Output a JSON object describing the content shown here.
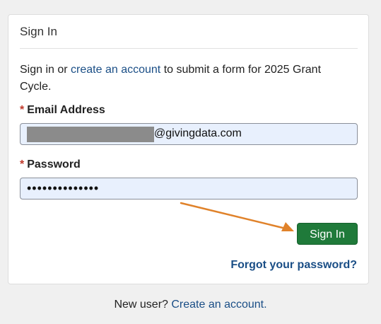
{
  "card": {
    "title": "Sign In",
    "intro_prefix": "Sign in or ",
    "intro_link": "create an account",
    "intro_suffix": " to submit a form for 2025 Grant Cycle."
  },
  "email": {
    "required_mark": "*",
    "label": "Email Address",
    "value_visible": "@givingdata.com"
  },
  "password": {
    "required_mark": "*",
    "label": "Password",
    "masked_value": "••••••••••••••"
  },
  "actions": {
    "sign_in_label": "Sign In",
    "forgot_label": "Forgot your password?"
  },
  "footer": {
    "prefix": "New user? ",
    "link": "Create an account."
  },
  "colors": {
    "primary_button": "#1f7a3a",
    "link": "#1a4e86",
    "required": "#c0392b",
    "annotation_arrow": "#e0822a"
  }
}
